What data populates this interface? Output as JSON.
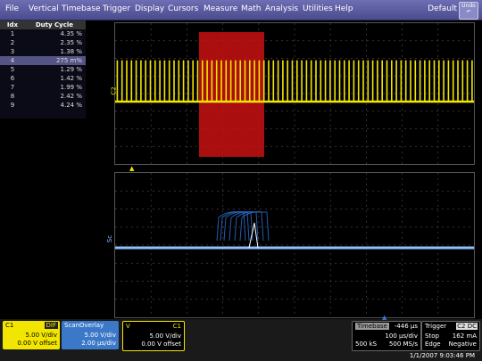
{
  "menu": {
    "items": [
      "File",
      "Vertical",
      "Timebase",
      "Trigger",
      "Display",
      "Cursors",
      "Measure",
      "Math",
      "Analysis",
      "Utilities",
      "Help"
    ],
    "default_label": "Default",
    "undo_label": "Undo"
  },
  "table": {
    "headers": [
      "Idx",
      "Duty Cycle"
    ],
    "rows": [
      {
        "idx": "1",
        "val": "4.35 %"
      },
      {
        "idx": "2",
        "val": "2.35 %"
      },
      {
        "idx": "3",
        "val": "1.38 %"
      },
      {
        "idx": "4",
        "val": "275 m%"
      },
      {
        "idx": "5",
        "val": "1.29 %"
      },
      {
        "idx": "6",
        "val": "1.42 %"
      },
      {
        "idx": "7",
        "val": "1.99 %"
      },
      {
        "idx": "8",
        "val": "2.42 %"
      },
      {
        "idx": "9",
        "val": "4.24 %"
      }
    ],
    "selected_row": 3
  },
  "grid_labels": {
    "top_trace": "C2",
    "bottom_trace": "Sc"
  },
  "channels": {
    "c1": {
      "label": "C1",
      "tag": "DIF",
      "line1": "5.00 V/div",
      "line2": "0.00 V offset",
      "color": "#f2e600"
    },
    "scan": {
      "label": "ScanOverlay",
      "line1": "5.00 V/div",
      "line2": "2.00 µs/div",
      "color": "#3c78c8"
    },
    "v": {
      "label": "V",
      "tag": "C1",
      "line1": "5.00 V/div",
      "line2": "0.00 V offset",
      "color": "#f2e600"
    }
  },
  "timebase": {
    "label": "Timebase",
    "value": "-446 µs",
    "per_div": "100 µs/div",
    "samples": "500 kS",
    "rate": "500 MS/s"
  },
  "trigger": {
    "label": "Trigger",
    "tag": "C2 DC",
    "mode": "Stop",
    "level": "162 mA",
    "type": "Edge",
    "slope": "Negative"
  },
  "datetime": "1/1/2007 9:03:46 PM"
}
